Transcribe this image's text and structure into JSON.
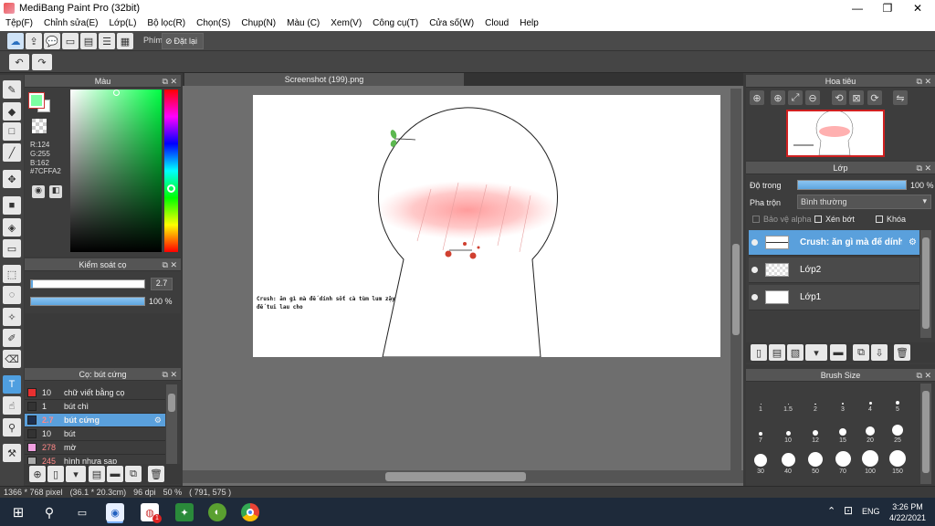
{
  "window": {
    "title": "MediBang Paint Pro (32bit)",
    "controls": {
      "minimize": "—",
      "maximize": "❐",
      "close": "✕"
    }
  },
  "menu": [
    "Tệp(F)",
    "Chỉnh sửa(E)",
    "Lớp(L)",
    "Bộ lọc(R)",
    "Chọn(S)",
    "Chụp(N)",
    "Màu (C)",
    "Xem(V)",
    "Công cụ(T)",
    "Cửa số(W)",
    "Cloud",
    "Help"
  ],
  "toolbar": {
    "phim_label": "Phím",
    "reset_label": "Đặt lại"
  },
  "color_panel": {
    "title": "Màu",
    "r": "R:124",
    "g": "G:255",
    "b": "B:162",
    "hex": "#7CFFA2",
    "fg_color": "#7CFFA2",
    "bg_color": "#ffffff"
  },
  "brush_control": {
    "title": "Kiểm soát cọ",
    "size_value": "2.7",
    "opacity_value": "100 %",
    "opacity_fraction": 1.0
  },
  "brush_list": {
    "title": "Cọ: bút cứng",
    "items": [
      {
        "color": "#e83030",
        "size": "10",
        "name": "chữ viết bằng cọ"
      },
      {
        "color": "#333333",
        "size": "1",
        "name": "bút chì"
      },
      {
        "color": "#1e3050",
        "size": "2.7",
        "name": "bút cứng",
        "selected": true
      },
      {
        "color": "#333333",
        "size": "10",
        "name": "bút"
      },
      {
        "color": "#f0a0e0",
        "size": "278",
        "name": "mờ"
      },
      {
        "color": "#aaaaaa",
        "size": "245",
        "name": "hình nhựa sạp"
      }
    ]
  },
  "canvas": {
    "tab_title": "Screenshot (199).png",
    "caption_line1": "Crush: ăn gì mà đế dính sốt cà tùm lum zậy",
    "caption_line2": "đế tui lau cho"
  },
  "navigator": {
    "title": "Hoa tiêu"
  },
  "layers": {
    "title": "Lớp",
    "opacity_label": "Độ trong",
    "opacity_value": "100 %",
    "opacity_fraction": 1.0,
    "blend_label": "Pha trộn",
    "blend_value": "Bình thường",
    "protect_alpha": "Bảo vệ alpha",
    "clip": "Xén bớt",
    "lock": "Khóa",
    "items": [
      {
        "name": "Crush: ăn gì mà đế dính",
        "selected": true
      },
      {
        "name": "Lớp2",
        "selected": false
      },
      {
        "name": "Lớp1",
        "selected": false
      }
    ]
  },
  "brush_size": {
    "title": "Brush Size",
    "sizes": [
      "1",
      "1.5",
      "2",
      "3",
      "4",
      "5",
      "7",
      "10",
      "12",
      "15",
      "20",
      "25",
      "30",
      "40",
      "50",
      "70",
      "100",
      "150"
    ]
  },
  "status": {
    "size": "1366 * 768 pixel",
    "cm": "(36.1 * 20.3cm)",
    "dpi": "96 dpi",
    "zoom": "50 %",
    "coords": "( 791, 575 )"
  },
  "taskbar": {
    "lang": "ENG",
    "time": "3:26 PM",
    "date": "4/22/2021",
    "badge": "1"
  }
}
